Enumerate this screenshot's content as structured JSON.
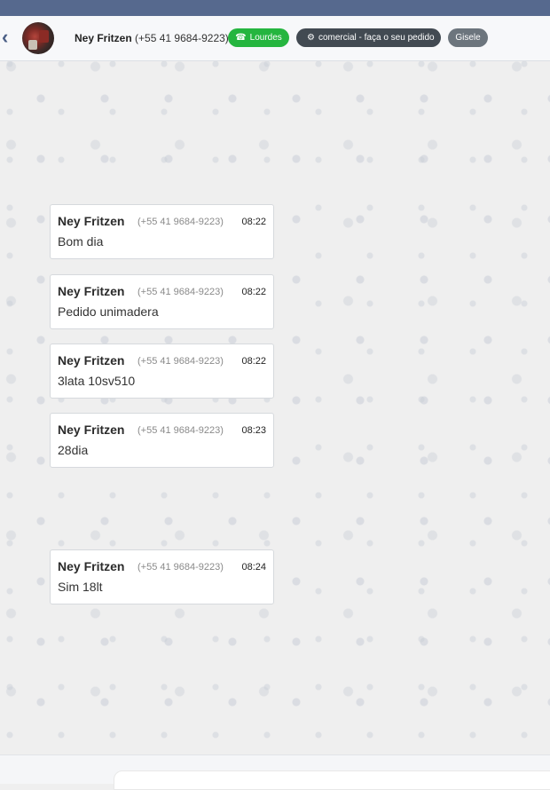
{
  "header": {
    "back_icon": "chevron-left-icon",
    "contact_name": "Ney Fritzen",
    "contact_phone": "(+55 41 9684-9223)",
    "tags": [
      {
        "label": "Lourdes",
        "icon": "whatsapp-icon",
        "color": "#25b53f"
      },
      {
        "label": "comercial - faça o seu pedido",
        "icon": "sitemap-icon",
        "color": "#424a52"
      },
      {
        "label": "Gisele",
        "color": "#6c757d"
      }
    ]
  },
  "messages": [
    {
      "sender": "Ney Fritzen",
      "phone": "(+55 41 9684-9223)",
      "time": "08:22",
      "text": "Bom dia"
    },
    {
      "sender": "Ney Fritzen",
      "phone": "(+55 41 9684-9223)",
      "time": "08:22",
      "text": "Pedido unimadera"
    },
    {
      "sender": "Ney Fritzen",
      "phone": "(+55 41 9684-9223)",
      "time": "08:22",
      "text": "3lata 10sv510"
    },
    {
      "sender": "Ney Fritzen",
      "phone": "(+55 41 9684-9223)",
      "time": "08:23",
      "text": "28dia"
    },
    {
      "sender": "Ney Fritzen",
      "phone": "(+55 41 9684-9223)",
      "time": "08:24",
      "text": "Sim 18lt"
    }
  ],
  "colors": {
    "topbar": "#56698e",
    "chat_background": "#efefef"
  }
}
